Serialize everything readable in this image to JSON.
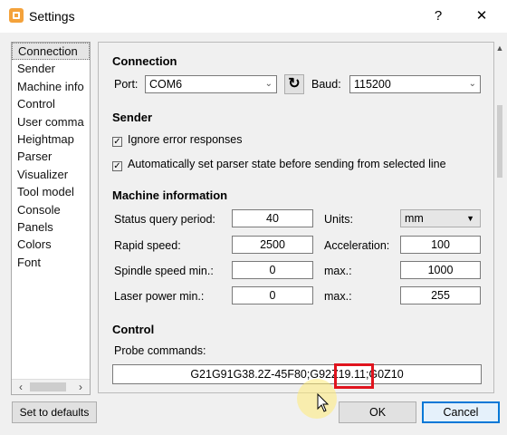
{
  "window": {
    "title": "Settings",
    "help_label": "?",
    "close_label": "✕"
  },
  "nav": {
    "items": [
      "Connection",
      "Sender",
      "Machine info",
      "Control",
      "User comma",
      "Heightmap",
      "Parser",
      "Visualizer",
      "Tool model",
      "Console",
      "Panels",
      "Colors",
      "Font"
    ],
    "selected": "Connection"
  },
  "connection": {
    "heading": "Connection",
    "port_label": "Port:",
    "port_value": "COM6",
    "baud_label": "Baud:",
    "baud_value": "115200"
  },
  "sender": {
    "heading": "Sender",
    "ignore_errors_label": "Ignore error responses",
    "auto_parser_label": "Automatically set parser state before sending from selected line"
  },
  "machine": {
    "heading": "Machine information",
    "status_query_label": "Status query period:",
    "status_query_value": "40",
    "units_label": "Units:",
    "units_value": "mm",
    "rapid_speed_label": "Rapid speed:",
    "rapid_speed_value": "2500",
    "acceleration_label": "Acceleration:",
    "acceleration_value": "100",
    "spindle_min_label": "Spindle speed min.:",
    "spindle_min_value": "0",
    "spindle_max_label": "max.:",
    "spindle_max_value": "1000",
    "laser_min_label": "Laser power min.:",
    "laser_min_value": "0",
    "laser_max_label": "max.:",
    "laser_max_value": "255"
  },
  "control": {
    "heading": "Control",
    "probe_label": "Probe commands:",
    "probe_value": "G21G91G38.2Z-45F80;G92Z19.11;G0Z10"
  },
  "buttons": {
    "defaults": "Set to defaults",
    "ok": "OK",
    "cancel": "Cancel"
  },
  "colors": {
    "highlight": "#e0141e",
    "accent": "#0078d7"
  }
}
